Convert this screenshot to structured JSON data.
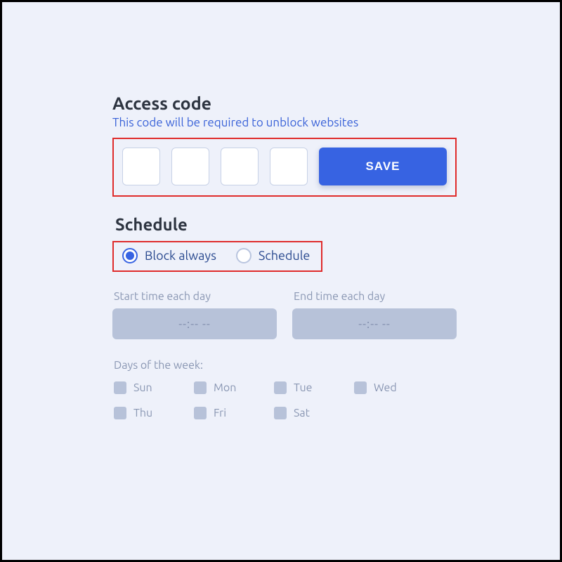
{
  "access": {
    "heading": "Access code",
    "subtitle": "This code will be required to unblock websites",
    "digits": [
      "",
      "",
      "",
      ""
    ],
    "save_label": "SAVE"
  },
  "schedule": {
    "heading": "Schedule",
    "options": {
      "block_always": {
        "label": "Block always",
        "selected": true
      },
      "schedule": {
        "label": "Schedule",
        "selected": false
      }
    },
    "start_label": "Start time each day",
    "end_label": "End time each day",
    "start_value": "--:-- --",
    "end_value": "--:-- --",
    "days_label": "Days of the week:",
    "days": [
      {
        "label": "Sun",
        "checked": false
      },
      {
        "label": "Mon",
        "checked": false
      },
      {
        "label": "Tue",
        "checked": false
      },
      {
        "label": "Wed",
        "checked": false
      },
      {
        "label": "Thu",
        "checked": false
      },
      {
        "label": "Fri",
        "checked": false
      },
      {
        "label": "Sat",
        "checked": false
      }
    ]
  }
}
